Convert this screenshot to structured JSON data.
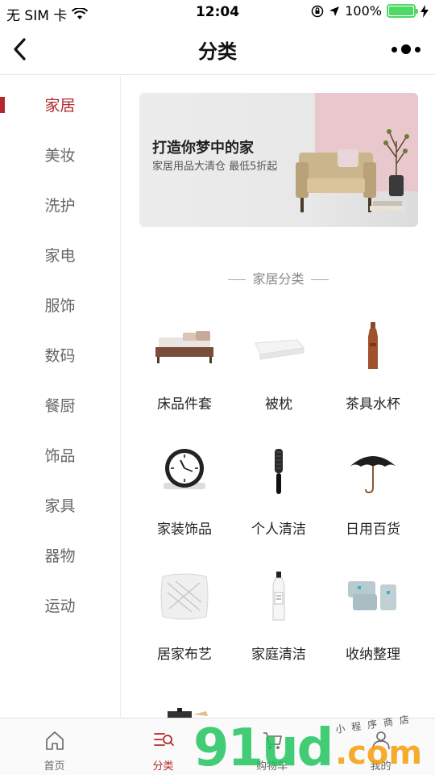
{
  "status_bar": {
    "carrier": "无 SIM 卡",
    "time": "12:04",
    "battery": "100%",
    "battery_level": 1.0
  },
  "nav": {
    "title": "分类",
    "back_icon": "chevron-left-icon",
    "more_icon": "more-dots-icon"
  },
  "sidebar": {
    "items": [
      {
        "label": "家居",
        "active": true
      },
      {
        "label": "美妆"
      },
      {
        "label": "洗护"
      },
      {
        "label": "家电"
      },
      {
        "label": "服饰"
      },
      {
        "label": "数码"
      },
      {
        "label": "餐厨"
      },
      {
        "label": "饰品"
      },
      {
        "label": "家具"
      },
      {
        "label": "器物"
      },
      {
        "label": "运动"
      }
    ]
  },
  "banner": {
    "title": "打造你梦中的家",
    "subtitle": "家居用品大清仓 最低5折起"
  },
  "section": {
    "title": "家居分类"
  },
  "categories": [
    {
      "label": "床品件套",
      "icon": "bed-icon"
    },
    {
      "label": "被枕",
      "icon": "folded-quilt-icon"
    },
    {
      "label": "茶具水杯",
      "icon": "bottle-icon"
    },
    {
      "label": "家装饰品",
      "icon": "clock-icon"
    },
    {
      "label": "个人清洁",
      "icon": "hairbrush-icon"
    },
    {
      "label": "日用百货",
      "icon": "umbrella-icon"
    },
    {
      "label": "居家布艺",
      "icon": "pillow-icon"
    },
    {
      "label": "家庭清洁",
      "icon": "detergent-bottle-icon"
    },
    {
      "label": "收纳整理",
      "icon": "storage-bags-icon"
    }
  ],
  "tabs": [
    {
      "label": "首页",
      "icon": "home-icon"
    },
    {
      "label": "分类",
      "icon": "category-icon",
      "active": true
    },
    {
      "label": "购物车",
      "icon": "cart-icon"
    },
    {
      "label": "我的",
      "icon": "user-icon"
    }
  ],
  "watermark": {
    "brand": "91ud",
    "domain": ".com",
    "caption": "小程序商店"
  },
  "colors": {
    "accent": "#b4282d",
    "battery": "#4cd964"
  }
}
